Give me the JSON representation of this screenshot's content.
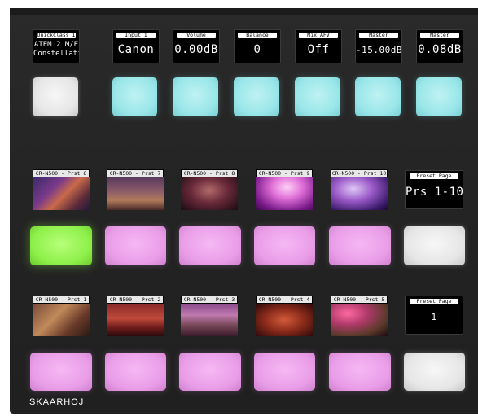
{
  "quick_display": {
    "header": "QuickClass 1",
    "line1": "ATEM 2 M/E",
    "line2": "Constellati"
  },
  "top_displays": [
    {
      "header": "Input 1",
      "value": "Canon"
    },
    {
      "header": "Volume",
      "value": "0.00dB"
    },
    {
      "header": "Balance",
      "value": "0"
    },
    {
      "header": "Mix AFV",
      "value": "Off"
    },
    {
      "header": "Master",
      "value": "-15.00dB"
    },
    {
      "header": "Master",
      "value": "0.08dB"
    }
  ],
  "presets_upper": [
    {
      "label": "CR-N500 - Prst 6",
      "scene": "guitar-closeup"
    },
    {
      "label": "CR-N500 - Prst 7",
      "scene": "band-stage"
    },
    {
      "label": "CR-N500 - Prst 8",
      "scene": "duo-singers"
    },
    {
      "label": "CR-N500 - Prst 9",
      "scene": "singer-silhouette-pink"
    },
    {
      "label": "CR-N500 - Prst 10",
      "scene": "singer-silhouette-purple"
    }
  ],
  "preset_page_upper": {
    "header": "Preset Page",
    "value": "Prs 1-10"
  },
  "presets_lower": [
    {
      "label": "CR-N500 - Prst 1",
      "scene": "guitarist-warm"
    },
    {
      "label": "CR-N500 - Prst 2",
      "scene": "guitarist-red"
    },
    {
      "label": "CR-N500 - Prst 3",
      "scene": "drummer-stage"
    },
    {
      "label": "CR-N500 - Prst 4",
      "scene": "band-red-stage"
    },
    {
      "label": "CR-N500 - Prst 5",
      "scene": "guitarist-lights"
    }
  ],
  "preset_page_lower": {
    "header": "Preset Page",
    "value": "1"
  },
  "brand": "SKAARHOJ",
  "colors": {
    "white": "#e8e8e8",
    "cyan": "#99e6e9",
    "pink": "#e99de7",
    "green": "#8ef04a",
    "panel": "#252525"
  }
}
